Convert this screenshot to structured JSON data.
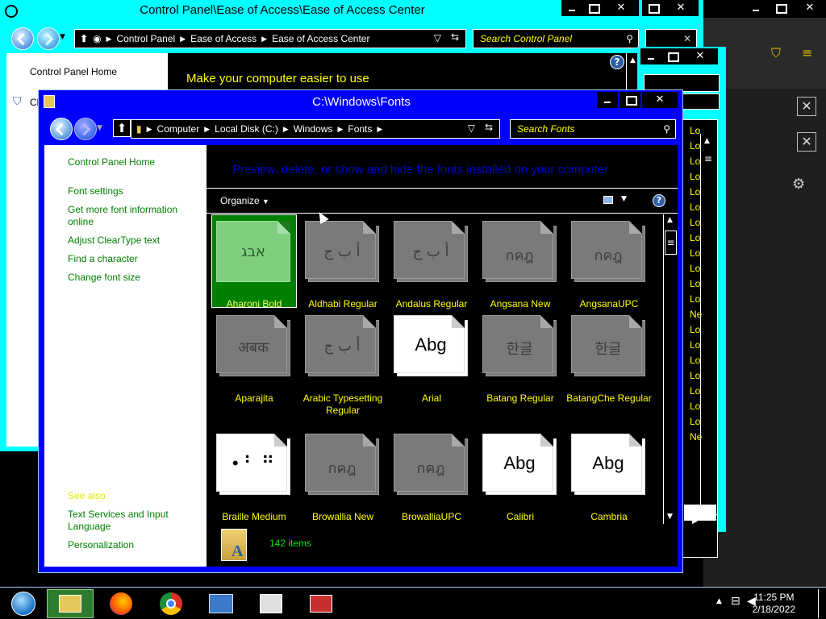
{
  "ease_window": {
    "title": "Control Panel\\Ease of Access\\Ease of Access Center",
    "breadcrumb": [
      "Control Panel",
      "Ease of Access",
      "Ease of Access Center"
    ],
    "search_placeholder": "Search Control Panel",
    "left_link": "Control Panel Home",
    "left_link2": "Cl",
    "heading": "Make your computer easier to use"
  },
  "fonts_window": {
    "title": "C:\\Windows\\Fonts",
    "breadcrumb": [
      "Computer",
      "Local Disk (C:)",
      "Windows",
      "Fonts"
    ],
    "search_placeholder": "Search Fonts",
    "description": "Preview, delete, or show and hide the fonts installed on your computer",
    "organize_label": "Organize",
    "sidebar": {
      "home": "Control Panel Home",
      "links": [
        "Font settings",
        "Get more font information online",
        "Adjust ClearType text",
        "Find a character",
        "Change font size"
      ],
      "see_also": "See also",
      "see_also_links": [
        "Text Services and Input Language",
        "Personalization"
      ]
    },
    "fonts": [
      {
        "name": "Aharoni Bold",
        "glyph": "אבג",
        "style": "green"
      },
      {
        "name": "Aldhabi Regular",
        "glyph": "أ ب ج",
        "style": "dark"
      },
      {
        "name": "Andalus Regular",
        "glyph": "أ ب ج",
        "style": "dark"
      },
      {
        "name": "Angsana New",
        "glyph": "กคฎ",
        "style": "dark"
      },
      {
        "name": "AngsanaUPC",
        "glyph": "กคฎ",
        "style": "dark"
      },
      {
        "name": "Aparajita",
        "glyph": "अबक",
        "style": "dark"
      },
      {
        "name": "Arabic Typesetting Regular",
        "glyph": "أ ب ج",
        "style": "dark"
      },
      {
        "name": "Arial",
        "glyph": "Abg",
        "style": "light"
      },
      {
        "name": "Batang Regular",
        "glyph": "한글",
        "style": "dark"
      },
      {
        "name": "BatangChe Regular",
        "glyph": "한글",
        "style": "dark"
      },
      {
        "name": "Braille Medium",
        "glyph": "• ⠃ ⠛",
        "style": "light"
      },
      {
        "name": "Browallia New",
        "glyph": "กคฎ",
        "style": "dark"
      },
      {
        "name": "BrowalliaUPC",
        "glyph": "กคฎ",
        "style": "dark"
      },
      {
        "name": "Calibri",
        "glyph": "Abg",
        "style": "light"
      },
      {
        "name": "Cambria",
        "glyph": "Abg",
        "style": "light"
      }
    ],
    "item_count": "142 items"
  },
  "right_list": {
    "items": [
      "Lo",
      "Lo",
      "Lo",
      "Lo",
      "Lo",
      "Lo",
      "Lo",
      "Lo",
      "Lo",
      "Lo",
      "Lo",
      "Lo",
      "Ne",
      "Lo",
      "Lo",
      "Lo",
      "Lo",
      "Lo",
      "Lo",
      "Lo",
      "Ne"
    ]
  },
  "taskbar": {
    "time": "11:25 PM",
    "date": "2/18/2022"
  },
  "colors": {
    "cyan": "#00ffff",
    "blue": "#0000ff",
    "link_green": "#008000",
    "label_yellow": "#ffff00"
  }
}
